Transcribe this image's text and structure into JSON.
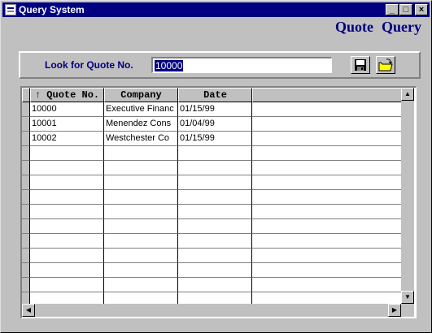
{
  "window": {
    "title": "Query System",
    "minimize": "_",
    "maximize": "□",
    "close": "×"
  },
  "heading": {
    "word1": "Quote",
    "word2": "Query"
  },
  "search": {
    "label": "Look for Quote No.",
    "value": "10000"
  },
  "toolbar": {
    "save_icon": "floppy-disk-icon",
    "open_icon": "open-folder-icon"
  },
  "grid": {
    "columns": [
      "↑ Quote No.",
      "Company",
      "Date",
      ""
    ],
    "rows": [
      [
        "10000",
        "Executive Financ",
        "01/15/99",
        ""
      ],
      [
        "10001",
        "Menendez Cons",
        "01/04/99",
        ""
      ],
      [
        "10002",
        "Westchester Co",
        "01/15/99",
        ""
      ],
      [
        "",
        "",
        "",
        ""
      ],
      [
        "",
        "",
        "",
        ""
      ],
      [
        "",
        "",
        "",
        ""
      ],
      [
        "",
        "",
        "",
        ""
      ],
      [
        "",
        "",
        "",
        ""
      ],
      [
        "",
        "",
        "",
        ""
      ],
      [
        "",
        "",
        "",
        ""
      ],
      [
        "",
        "",
        "",
        ""
      ],
      [
        "",
        "",
        "",
        ""
      ],
      [
        "",
        "",
        "",
        ""
      ],
      [
        "",
        "",
        "",
        ""
      ]
    ]
  },
  "scroll": {
    "up": "▲",
    "down": "▼",
    "left": "◀",
    "right": "▶"
  }
}
